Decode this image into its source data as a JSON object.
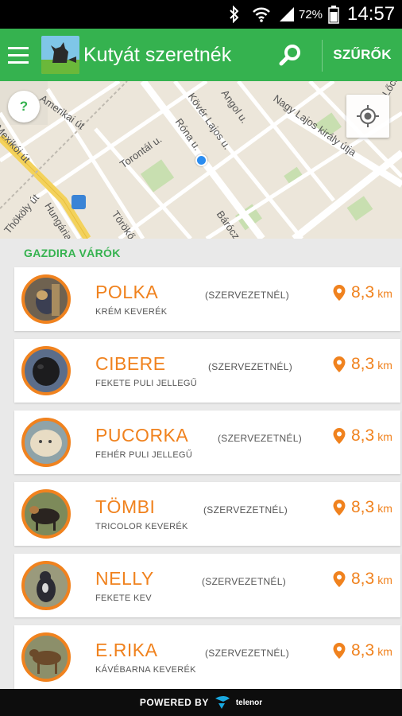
{
  "status_bar": {
    "battery_percent": "72%",
    "time": "14:57",
    "icons": [
      "bluetooth-icon",
      "wifi-icon",
      "signal-icon",
      "battery-icon"
    ]
  },
  "app_bar": {
    "title": "Kutyát szeretnék",
    "filter_label": "SZŰRŐK",
    "accent_color": "#35b24f"
  },
  "map": {
    "help_label": "?",
    "street_labels": [
      "Amerikai út",
      "Mexikói út",
      "Róna u.",
      "Kövér Lajos u.",
      "Angol u.",
      "Nagy Lajos király útja",
      "Torontál u.",
      "Thököly út",
      "Hungária",
      "Törökő",
      "Bárócz",
      "Lőcsei"
    ]
  },
  "list": {
    "section_title": "GAZDIRA VÁRÓK",
    "accent_color": "#f0821e",
    "dogs": [
      {
        "name": "POLKA",
        "breed": "KRÉM KEVERÉK",
        "status": "(SZERVEZETNÉL)",
        "distance": "8,3",
        "unit": "km"
      },
      {
        "name": "CIBERE",
        "breed": "FEKETE PULI JELLEGŰ",
        "status": "(SZERVEZETNÉL)",
        "distance": "8,3",
        "unit": "km"
      },
      {
        "name": "PUCORKA",
        "breed": "FEHÉR PULI JELLEGŰ",
        "status": "(SZERVEZETNÉL)",
        "distance": "8,3",
        "unit": "km"
      },
      {
        "name": "TÖMBI",
        "breed": "TRICOLOR KEVERÉK",
        "status": "(SZERVEZETNÉL)",
        "distance": "8,3",
        "unit": "km"
      },
      {
        "name": "NELLY",
        "breed": "FEKETE KEV",
        "status": "(SZERVEZETNÉL)",
        "distance": "8,3",
        "unit": "km"
      },
      {
        "name": "E.RIKA",
        "breed": "KÁVÉBARNA KEVERÉK",
        "status": "(SZERVEZETNÉL)",
        "distance": "8,3",
        "unit": "km"
      }
    ]
  },
  "footer": {
    "powered_by": "POWERED BY",
    "brand": "telenor"
  }
}
